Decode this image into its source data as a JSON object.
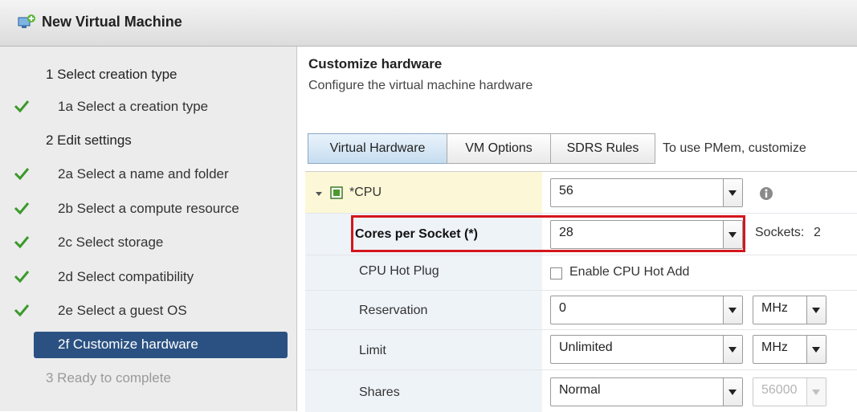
{
  "window": {
    "title": "New Virtual Machine"
  },
  "sidebar": {
    "steps": [
      {
        "label": "1  Select creation type",
        "kind": "group",
        "checked": false
      },
      {
        "label": "1a  Select a creation type",
        "kind": "sub",
        "checked": true
      },
      {
        "label": "2  Edit settings",
        "kind": "group",
        "checked": false
      },
      {
        "label": "2a  Select a name and folder",
        "kind": "sub",
        "checked": true
      },
      {
        "label": "2b  Select a compute resource",
        "kind": "sub",
        "checked": true
      },
      {
        "label": "2c  Select storage",
        "kind": "sub",
        "checked": true
      },
      {
        "label": "2d  Select compatibility",
        "kind": "sub",
        "checked": true
      },
      {
        "label": "2e  Select a guest OS",
        "kind": "sub",
        "checked": true
      },
      {
        "label": "2f  Customize hardware",
        "kind": "active",
        "checked": false
      },
      {
        "label": "3  Ready to complete",
        "kind": "pending",
        "checked": false
      }
    ]
  },
  "main": {
    "title": "Customize hardware",
    "subtitle": "Configure the virtual machine hardware",
    "tabs": [
      {
        "label": "Virtual Hardware",
        "active": true
      },
      {
        "label": "VM Options",
        "active": false
      },
      {
        "label": "SDRS Rules",
        "active": false
      }
    ],
    "tabs_note": "To use PMem, customize"
  },
  "hardware": {
    "cpu": {
      "label": "*CPU",
      "value": "56"
    },
    "cores_per_socket": {
      "label": "Cores per Socket (*)",
      "value": "28",
      "sockets_label": "Sockets:",
      "sockets_value": "2"
    },
    "hot_plug": {
      "label": "CPU Hot Plug",
      "checkbox_label": "Enable CPU Hot Add",
      "checked": false
    },
    "reservation": {
      "label": "Reservation",
      "value": "0",
      "unit": "MHz"
    },
    "limit": {
      "label": "Limit",
      "value": "Unlimited",
      "unit": "MHz"
    },
    "shares": {
      "label": "Shares",
      "value": "Normal",
      "amount": "56000"
    }
  },
  "colors": {
    "accent": "#2a5182",
    "check": "#3a9a2a",
    "highlight_box": "#d4161c",
    "cpu_row": "#fcf7d6"
  },
  "icons": {
    "title": "vm-add-icon",
    "check": "checkmark-icon",
    "cpu": "cpu-chip-icon",
    "info": "info-icon"
  }
}
